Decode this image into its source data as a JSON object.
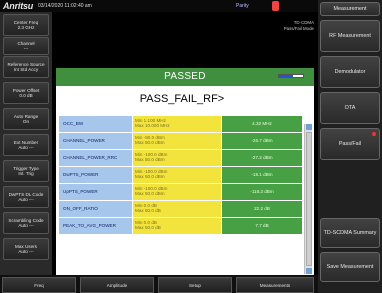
{
  "status_bar": {
    "logo": "Anritsu",
    "datetime": "03/14/2020 11:02:40 am",
    "mode_label": "Parity"
  },
  "info_panel": {
    "line1": "TD-CDMA",
    "line2": "Pass/Fail Mode"
  },
  "left_menu": [
    {
      "label": "Center Freq",
      "value": "2.3 GHz"
    },
    {
      "label": "Channel",
      "value": "---"
    },
    {
      "label": "Reference Source",
      "value": "Int Std Accy"
    },
    {
      "label": "Power Offset",
      "value": "0.0 dB"
    },
    {
      "label": "Auto Range",
      "value": "On"
    },
    {
      "label": "Ext Number",
      "value": "Auto ---"
    },
    {
      "label": "Trigger Type",
      "value": "Int. Trig"
    },
    {
      "label": "DwPTS DL Code",
      "value": "Auto ---"
    },
    {
      "label": "Scrambling Code",
      "value": "Auto ---"
    },
    {
      "label": "Max Users",
      "value": "Auto ---"
    }
  ],
  "result_banner": {
    "text": "PASSED",
    "level": 0.6
  },
  "pass_fail_title": "PASS_FAIL_RF>",
  "table_rows": [
    {
      "name": "OCC_BW",
      "limits": "Min 1.100 MHz\nMax 10.000 MHz",
      "result": "4.32 MHz"
    },
    {
      "name": "CHANNEL_POWER",
      "limits": "Min -80.0 dBm\nMax 50.0 dBm",
      "result": "-26.7 dBm"
    },
    {
      "name": "CHANNEL_POWER_RRC",
      "limits": "Min -100.0 dBm\nMax 50.0 dBm",
      "result": "-27.2 dBm"
    },
    {
      "name": "DwPTS_POWER",
      "limits": "Min -100.0 dBm\nMax 50.0 dBm",
      "result": "-18.1 dBm"
    },
    {
      "name": "UpPTS_POWER",
      "limits": "Min -100.0 dBm\nMax 50.0 dBm",
      "result": "-118.3 dBm"
    },
    {
      "name": "ON_OFF_RATIO",
      "limits": "Min 0.0 dB\nMax 50.0 dB",
      "result": "22.2 dB"
    },
    {
      "name": "PEAK_TO_AVG_POWER",
      "limits": "Min 0.0 dB\nMax 50.0 dB",
      "result": "7.7 dB"
    }
  ],
  "right_menu": [
    {
      "label": "Measurement"
    },
    {
      "label": "RF Measurement"
    },
    {
      "label": "Demodulator"
    },
    {
      "label": "OTA"
    },
    {
      "label": "Pass/Fail"
    },
    {
      "label": "TD-SCDMA Summary"
    },
    {
      "label": "Save Measurement"
    }
  ],
  "bottom_tabs": [
    {
      "label": "Freq"
    },
    {
      "label": "Amplitude"
    },
    {
      "label": "Setup"
    },
    {
      "label": "Measurements"
    }
  ],
  "colors": {
    "pass_green": "#47a043",
    "banner_green": "#3f8f3f",
    "limit_yellow": "#f3e43d",
    "name_blue": "#a7c6ec",
    "alert_red": "#e44444"
  }
}
